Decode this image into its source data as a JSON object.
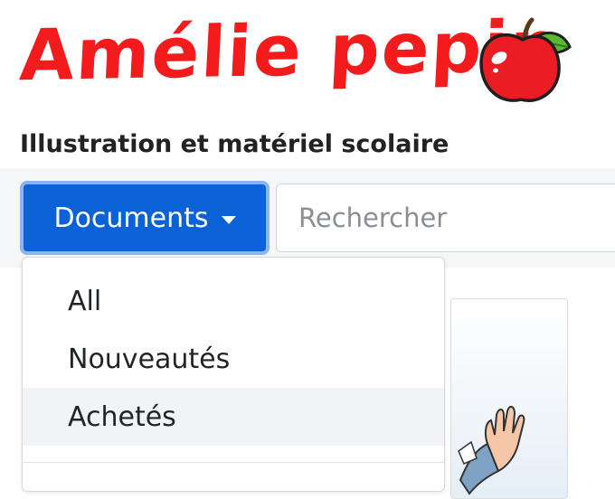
{
  "brand": {
    "name": "Amélie pepin",
    "tagline": "Illustration et matériel scolaire",
    "logo_icon": "apple-icon",
    "brand_color": "#f41b1d"
  },
  "toolbar": {
    "documents_label": "Documents",
    "documents_icon": "caret-down-icon",
    "search_placeholder": "Rechercher"
  },
  "dropdown": {
    "items": [
      {
        "label": "All"
      },
      {
        "label": "Nouveautés"
      },
      {
        "label": "Achetés"
      }
    ]
  },
  "colors": {
    "primary": "#0a62d6",
    "focus_ring": "#8bb4f0",
    "hover_bg": "#f1f3f5"
  }
}
